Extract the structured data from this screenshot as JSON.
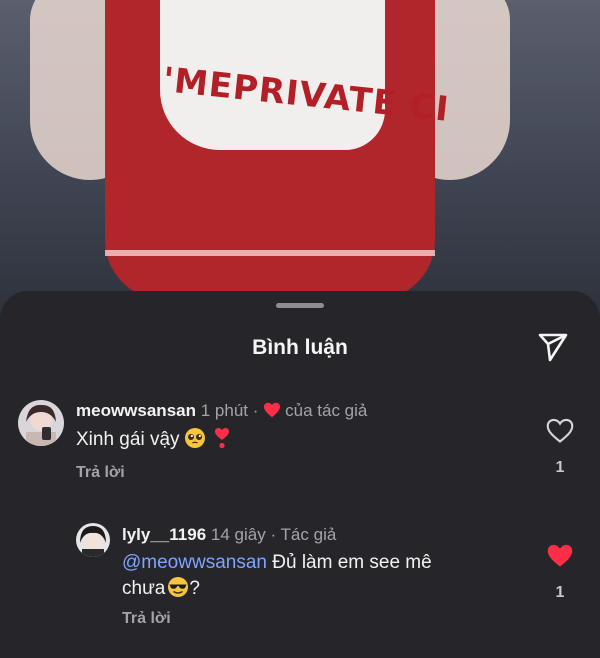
{
  "photo": {
    "shirt_text": "'MEPRIVATE CI"
  },
  "sheet": {
    "title": "Bình luận"
  },
  "comments": [
    {
      "username": "meowwsansan",
      "time": "1 phút",
      "separator": "·",
      "author_like": "của tác giả",
      "text": "Xinh gái vậy",
      "emoji_1": "pleading-face-icon",
      "emoji_2": "heart-exclamation-icon",
      "reply_label": "Trả lời",
      "like_count": "1",
      "liked": false
    },
    {
      "username": "lyly__1196",
      "time": "14 giây",
      "separator": "·",
      "author_tag": "Tác giả",
      "mention": "@meowwsansan",
      "text_line1": " Đủ làm em see mê",
      "text_line2": "chưa",
      "text_tail": "?",
      "emoji": "smiling-sunglasses-icon",
      "reply_label": "Trả lời",
      "like_count": "1",
      "liked": true
    }
  ],
  "colors": {
    "heart_red": "#ff2d47",
    "mention_blue": "#7ea4ff",
    "sheet_bg": "#26262a"
  }
}
